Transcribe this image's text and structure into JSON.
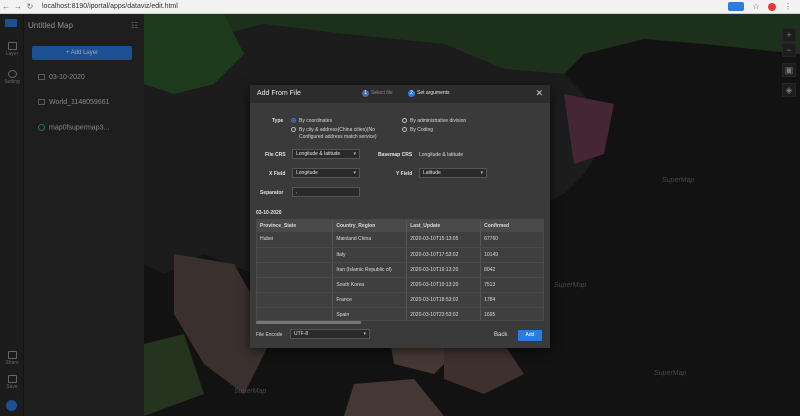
{
  "browser": {
    "url": "localhost:8190/iportal/apps/dataviz/edit.html"
  },
  "app": {
    "title": "Untitled Map"
  },
  "rail": {
    "layer_label": "Layer",
    "setting_label": "Setting",
    "share_label": "Share",
    "save_label": "Save"
  },
  "panel": {
    "add_layer": "+ Add Layer",
    "layers": [
      "03-10-2020",
      "World_1148059661",
      "map0fsupermap3..."
    ]
  },
  "map": {
    "watermark": "SuperMap",
    "tools": [
      "+",
      "−",
      "▣",
      "◈"
    ]
  },
  "dialog": {
    "title": "Add From File",
    "step1": {
      "num": "1",
      "label": "Select file"
    },
    "step2": {
      "num": "2",
      "label": "Set arguments"
    },
    "close": "✕",
    "type_label": "Type",
    "opt_coords": "By coordinates",
    "opt_admin": "By administrative division",
    "opt_city_1": "By city & address(China cities)(No",
    "opt_city_2": "Configured address match service)",
    "opt_coding": "By Coding",
    "file_crs_label": "File CRS",
    "file_crs_value": "Longitude & latitude",
    "basemap_crs_label": "Basemap CRS",
    "basemap_crs_value": "Longitude & latitude",
    "x_field_label": "X Field",
    "x_field_value": "Longitude",
    "y_field_label": "Y Field",
    "y_field_value": "Latitude",
    "separator_label": "Separator",
    "separator_value": ",",
    "file_name": "03-10-2020",
    "columns": [
      "Province_State",
      "Country_Region",
      "Last_Update",
      "Confirmed"
    ],
    "rows": [
      [
        "Hubei",
        "Mainland China",
        "2020-03-10T15:13:05",
        "67760"
      ],
      [
        "",
        "Italy",
        "2020-03-10T17:53:02",
        "10149"
      ],
      [
        "",
        "Iran (Islamic Republic of)",
        "2020-03-10T19:13:20",
        "8042"
      ],
      [
        "",
        "South Korea",
        "2020-03-10T19:13:20",
        "7513"
      ],
      [
        "",
        "France",
        "2020-03-10T18:53:02",
        "1784"
      ],
      [
        "",
        "Spain",
        "2020-03-10T23:53:02",
        "1695"
      ]
    ],
    "encode_label": "File Encode",
    "encode_value": "UTF-8",
    "back": "Back",
    "add": "Add"
  }
}
